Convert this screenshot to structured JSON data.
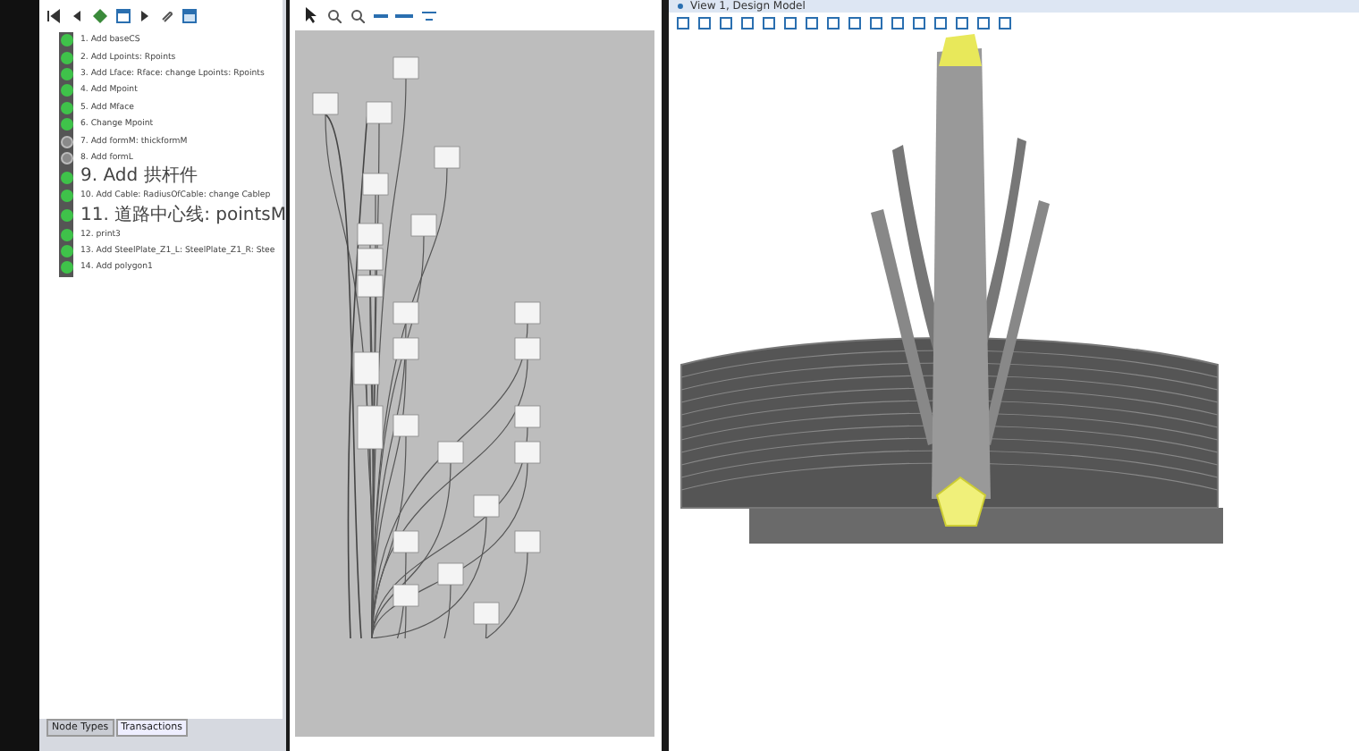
{
  "transactions": {
    "items": [
      {
        "label": "1. Add baseCS",
        "active": true
      },
      {
        "label": "2. Add Lpoints: Rpoints",
        "active": true
      },
      {
        "label": "3. Add Lface: Rface: change Lpoints: Rpoints",
        "active": true
      },
      {
        "label": "4. Add Mpoint",
        "active": true
      },
      {
        "label": "5. Add Mface",
        "active": true
      },
      {
        "label": "6. Change Mpoint",
        "active": true
      },
      {
        "label": "7. Add formM: thickformM",
        "active": false
      },
      {
        "label": "8. Add formL",
        "active": false
      },
      {
        "label": "9. Add 拱杆件",
        "active": true
      },
      {
        "label": "10. Add Cable: RadiusOfCable: change Cablep",
        "active": true
      },
      {
        "label": "11. 道路中心线: pointsM",
        "active": true
      },
      {
        "label": "12. print3",
        "active": true
      },
      {
        "label": "13. Add SteelPlate_Z1_L: SteelPlate_Z1_R: Stee",
        "active": true
      },
      {
        "label": "14. Add polygon1",
        "active": true
      }
    ],
    "tabs": [
      {
        "label": "Node Types",
        "selected": false
      },
      {
        "label": "Transactions",
        "selected": true
      }
    ]
  },
  "view": {
    "title": "View 1, Design Model"
  }
}
